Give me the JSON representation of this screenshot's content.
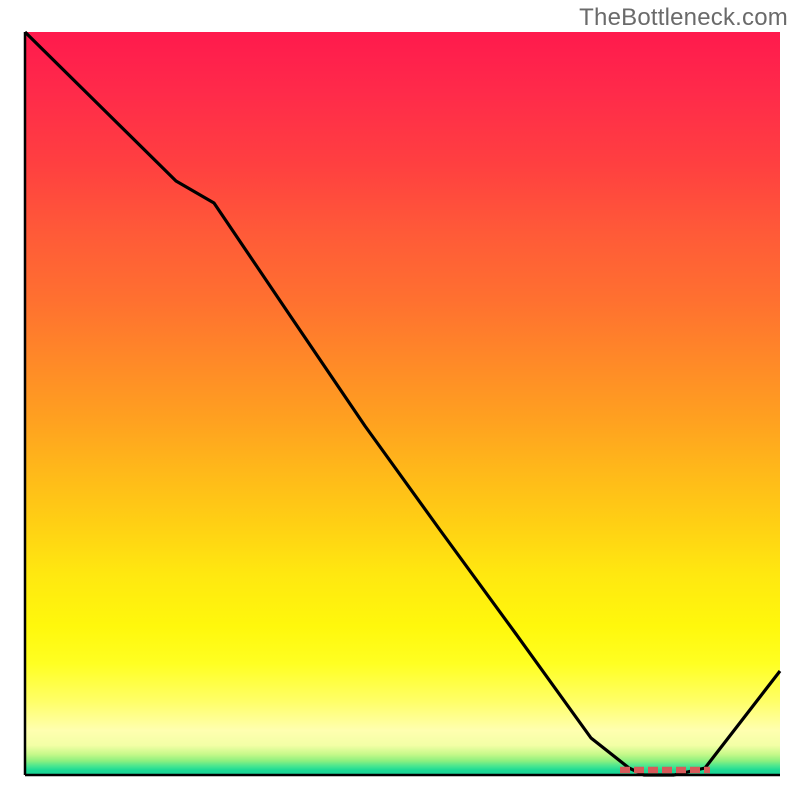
{
  "watermark": "TheBottleneck.com",
  "chart_data": {
    "type": "line",
    "title": "",
    "xlabel": "",
    "ylabel": "",
    "xlim": [
      0,
      100
    ],
    "ylim": [
      0,
      100
    ],
    "grid": false,
    "legend": false,
    "series": [
      {
        "name": "bottleneck-curve",
        "x": [
          0,
          10,
          20,
          25,
          35,
          45,
          55,
          65,
          75,
          80,
          82,
          86,
          90,
          100
        ],
        "values": [
          100,
          90,
          80,
          77,
          62,
          47,
          33,
          19,
          5,
          1,
          0,
          0,
          1,
          14
        ]
      }
    ],
    "optimal_region": {
      "start_x": 80,
      "end_x": 90,
      "y": 0
    }
  },
  "colors": {
    "gradient_top": "#ff1a4d",
    "gradient_mid": "#ffe810",
    "gradient_bottom": "#16d296",
    "curve": "#000000",
    "optimal_marker": "#d85a5a"
  }
}
